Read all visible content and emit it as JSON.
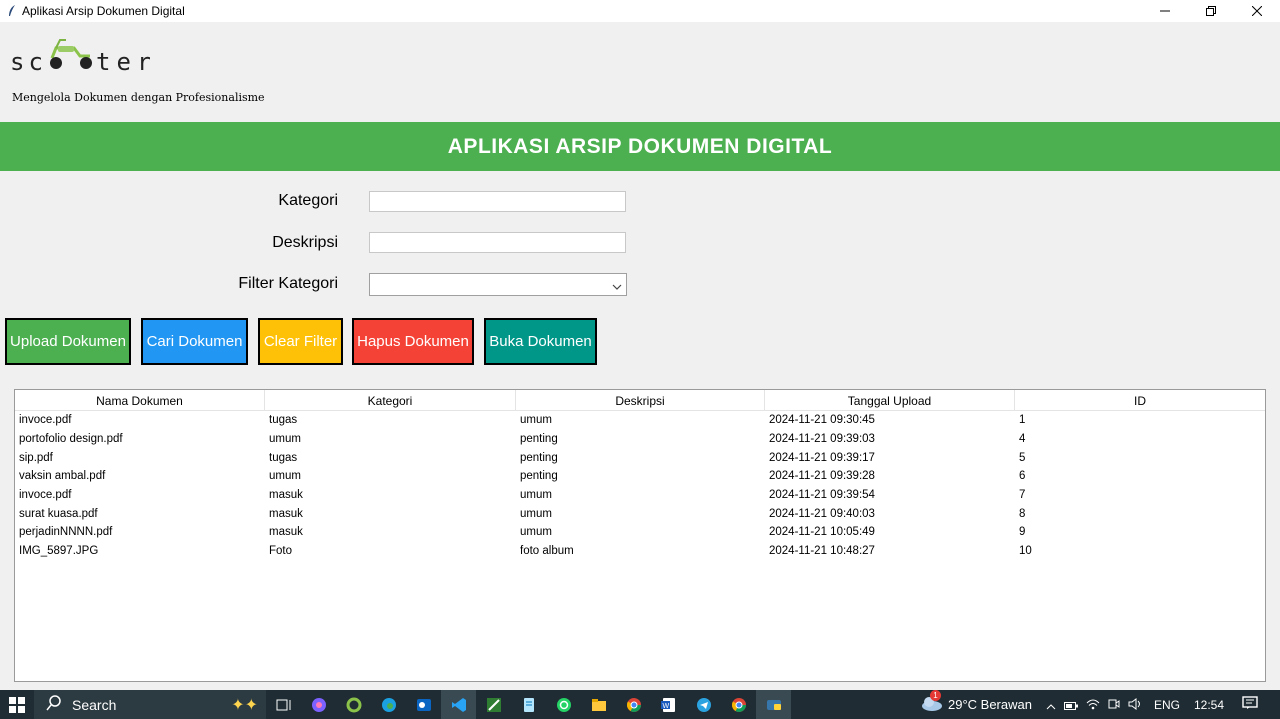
{
  "window": {
    "title": "Aplikasi Arsip Dokumen Digital"
  },
  "brand": {
    "logo_text": "sc  ter",
    "tagline": "Mengelola Dokumen dengan Profesionalisme"
  },
  "header": {
    "title": "APLIKASI ARSIP DOKUMEN DIGITAL",
    "color": "#4caf50"
  },
  "form": {
    "kategori_label": "Kategori",
    "kategori_value": "",
    "deskripsi_label": "Deskripsi",
    "deskripsi_value": "",
    "filter_label": "Filter Kategori",
    "filter_value": ""
  },
  "buttons": [
    {
      "label": "Upload Dokumen",
      "color": "#4caf50"
    },
    {
      "label": "Cari Dokumen",
      "color": "#2196f3"
    },
    {
      "label": "Clear Filter",
      "color": "#ffc107"
    },
    {
      "label": "Hapus Dokumen",
      "color": "#f44336"
    },
    {
      "label": "Buka Dokumen",
      "color": "#009688"
    }
  ],
  "table": {
    "columns": [
      "Nama Dokumen",
      "Kategori",
      "Deskripsi",
      "Tanggal Upload",
      "ID"
    ],
    "rows": [
      [
        "invoce.pdf",
        "tugas",
        "umum",
        "2024-11-21 09:30:45",
        "1"
      ],
      [
        "portofolio design.pdf",
        "umum",
        "penting",
        "2024-11-21 09:39:03",
        "4"
      ],
      [
        "sip.pdf",
        "tugas",
        "penting",
        "2024-11-21 09:39:17",
        "5"
      ],
      [
        "vaksin ambal.pdf",
        "umum",
        "penting",
        "2024-11-21 09:39:28",
        "6"
      ],
      [
        "invoce.pdf",
        "masuk",
        "umum",
        "2024-11-21 09:39:54",
        "7"
      ],
      [
        "surat kuasa.pdf",
        "masuk",
        "umum",
        "2024-11-21 09:40:03",
        "8"
      ],
      [
        "perjadinNNNN.pdf",
        "masuk",
        "umum",
        "2024-11-21 10:05:49",
        "9"
      ],
      [
        "IMG_5897.JPG",
        "Foto",
        "foto album",
        "2024-11-21 10:48:27",
        "10"
      ]
    ]
  },
  "taskbar": {
    "search_placeholder": "Search",
    "weather": "29°C  Berawan",
    "language": "ENG",
    "time": "12:54",
    "notification_count": "1"
  }
}
